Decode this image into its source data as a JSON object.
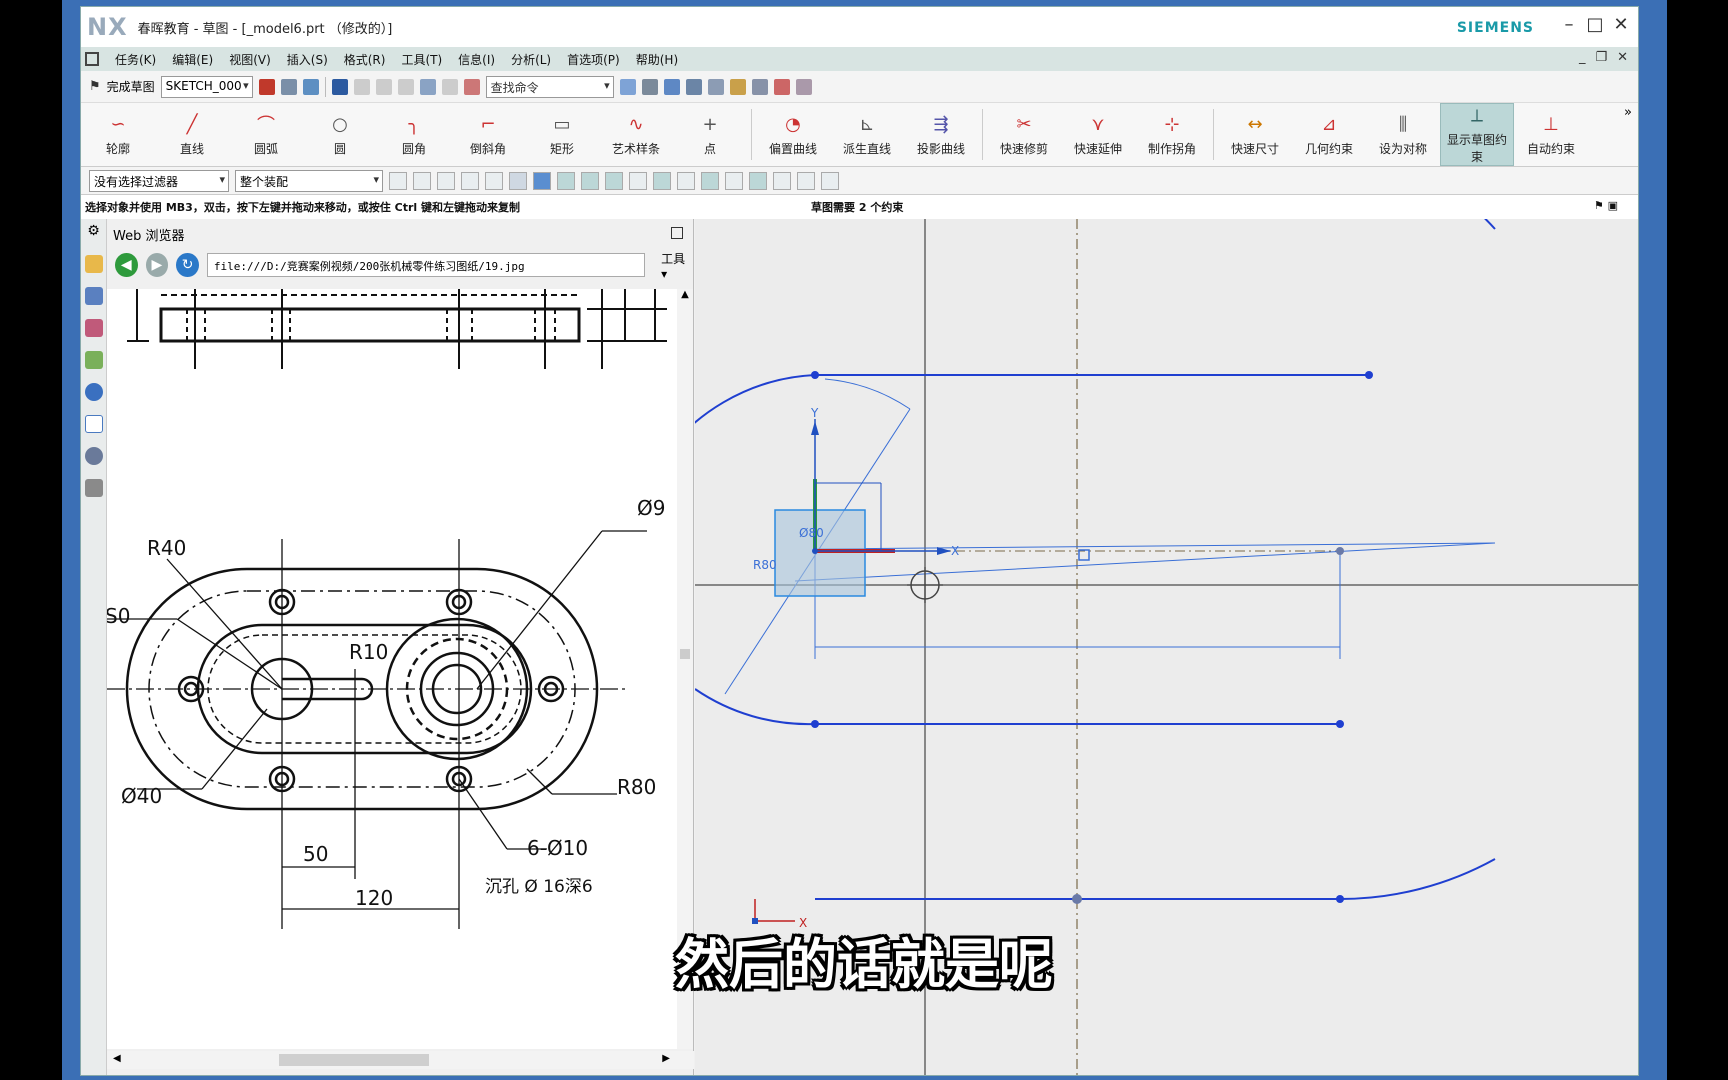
{
  "window": {
    "logo": "NX",
    "title": "春晖教育 - 草图 - [_model6.prt （修改的）]",
    "brand": "SIEMENS"
  },
  "menu": [
    "任务(K)",
    "编辑(E)",
    "视图(V)",
    "插入(S)",
    "格式(R)",
    "工具(T)",
    "信息(I)",
    "分析(L)",
    "首选项(P)",
    "帮助(H)"
  ],
  "toolbar1": {
    "finish_sketch": "完成草图",
    "sketch_name": "SKETCH_000",
    "search_placeholder": "查找命令"
  },
  "ribbon": {
    "items": [
      {
        "label": "轮廓",
        "icon": "profile-icon"
      },
      {
        "label": "直线",
        "icon": "line-icon"
      },
      {
        "label": "圆弧",
        "icon": "arc-icon"
      },
      {
        "label": "圆",
        "icon": "circle-icon"
      },
      {
        "label": "圆角",
        "icon": "fillet-icon"
      },
      {
        "label": "倒斜角",
        "icon": "chamfer-icon"
      },
      {
        "label": "矩形",
        "icon": "rectangle-icon"
      },
      {
        "label": "艺术样条",
        "icon": "spline-icon"
      },
      {
        "label": "点",
        "icon": "point-icon"
      },
      {
        "label": "偏置曲线",
        "icon": "offset-curve-icon"
      },
      {
        "label": "派生直线",
        "icon": "derived-line-icon"
      },
      {
        "label": "投影曲线",
        "icon": "project-curve-icon"
      },
      {
        "label": "快速修剪",
        "icon": "quick-trim-icon"
      },
      {
        "label": "快速延伸",
        "icon": "quick-extend-icon"
      },
      {
        "label": "制作拐角",
        "icon": "make-corner-icon"
      },
      {
        "label": "快速尺寸",
        "icon": "rapid-dimension-icon"
      },
      {
        "label": "几何约束",
        "icon": "geometric-constraint-icon"
      },
      {
        "label": "设为对称",
        "icon": "make-symmetric-icon"
      },
      {
        "label": "显示草图约束",
        "icon": "show-constraints-icon"
      },
      {
        "label": "自动约束",
        "icon": "auto-constraint-icon"
      }
    ]
  },
  "toolbar2": {
    "filter": "没有选择过滤器",
    "scope": "整个装配"
  },
  "status": {
    "hint": "选择对象并使用 MB3，双击，按下左键并拖动来移动，或按住 Ctrl 键和左键拖动来复制",
    "sketch_status": "草图需要 2 个约束"
  },
  "browser": {
    "title": "Web 浏览器",
    "url": "file:///D:/竞赛案例视频/200张机械零件练习图纸/19.jpg",
    "tools": "工具"
  },
  "drawing_labels": {
    "r40": "R40",
    "phi9": "Ø9",
    "s0": "S0",
    "r10": "R10",
    "phi40": "Ø40",
    "r80": "R80",
    "d50": "50",
    "six_phi10": "6-Ø10",
    "counterbore": "沉孔 Ø 16深6",
    "d120": "120"
  },
  "sketch_labels": {
    "y": "Y",
    "x": "X",
    "phi80": "Ø80",
    "r80": "R80"
  },
  "subtitle": "然后的话就是呢",
  "colors": {
    "sketch_curve": "#1f3fd0",
    "dimension": "#3a6fd6",
    "graphics_bg": "#ececec",
    "menubar": "#d8e4e2"
  }
}
